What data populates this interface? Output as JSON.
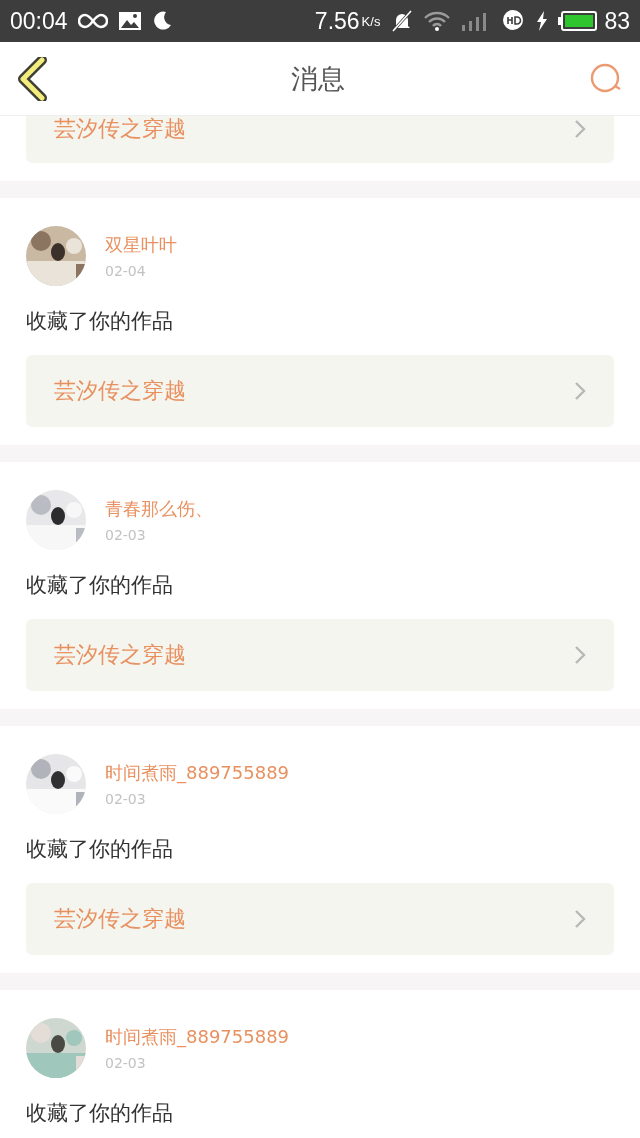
{
  "status_bar": {
    "time": "00:04",
    "speed": "7.56",
    "speed_unit": "K/s",
    "battery": "83"
  },
  "header": {
    "title": "消息"
  },
  "messages": [
    {
      "kind": "partial",
      "book": "芸汐传之穿越"
    },
    {
      "kind": "full",
      "user": "双星叶叶",
      "date": "02-04",
      "action": "收藏了你的作品",
      "book": "芸汐传之穿越"
    },
    {
      "kind": "full",
      "user": "青春那么伤、",
      "date": "02-03",
      "action": "收藏了你的作品",
      "book": "芸汐传之穿越"
    },
    {
      "kind": "full",
      "user": "时间煮雨_889755889",
      "date": "02-03",
      "action": "收藏了你的作品",
      "book": "芸汐传之穿越"
    },
    {
      "kind": "full",
      "user": "时间煮雨_889755889",
      "date": "02-03",
      "action": "收藏了你的作品"
    }
  ]
}
